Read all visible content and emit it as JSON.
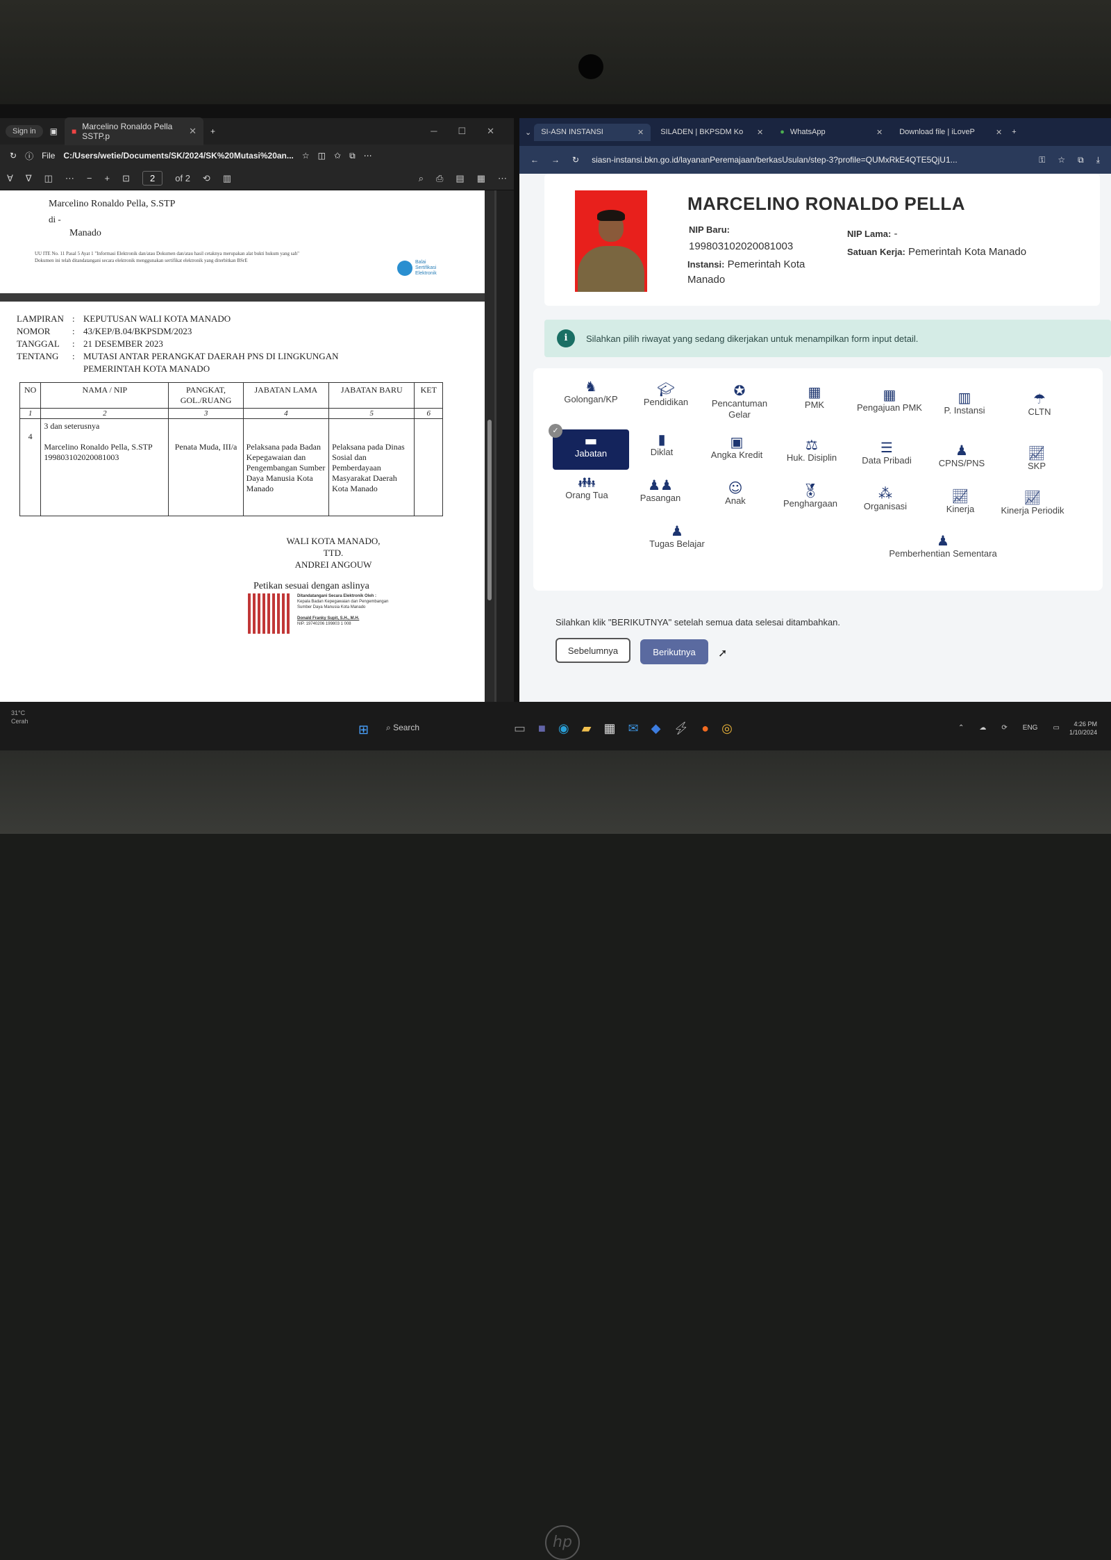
{
  "pdf": {
    "signin": "Sign in",
    "tab_title": "Marcelino Ronaldo Pella SSTP.p",
    "file_label": "File",
    "path": "C:/Users/wetie/Documents/SK/2024/SK%20Mutasi%20an...",
    "page_current": "2",
    "page_total": "of 2",
    "page1": {
      "name": "Marcelino Ronaldo Pella, S.STP",
      "di": "di -",
      "city": "Manado",
      "footnote1": "UU ITE No. 11 Pasal 5 Ayat 1 \"Informasi Elektronik dan/atau Dokumen dan/atau hasil cetaknya merupakan alat bukti hukum yang sah\"",
      "footnote2": "Dokumen ini telah ditandatangani secara elektronik menggunakan sertifikat elektronik yang diterbitkan BSrE",
      "bsre": "Balai Sertifikasi Elektronik"
    },
    "lampiran": {
      "k1": "LAMPIRAN",
      "v1": "KEPUTUSAN WALI KOTA MANADO",
      "k2": "NOMOR",
      "v2": "43/KEP/B.04/BKPSDM/2023",
      "k3": "TANGGAL",
      "v3": "21 DESEMBER 2023",
      "k4": "TENTANG",
      "v4": "MUTASI ANTAR PERANGKAT DAERAH PNS DI LINGKUNGAN",
      "v4b": "PEMERINTAH KOTA MANADO"
    },
    "table": {
      "h_no": "NO",
      "h_nama": "NAMA / NIP",
      "h_pangkat": "PANGKAT, GOL./RUANG",
      "h_lama": "JABATAN LAMA",
      "h_baru": "JABATAN BARU",
      "h_ket": "KET",
      "n1": "1",
      "n2": "2",
      "n3": "3",
      "n4": "4",
      "n5": "5",
      "n6": "6",
      "seterusnya": "3 dan seterusnya",
      "row_no": "4",
      "row_nama": "Marcelino Ronaldo Pella, S.STP 199803102020081003",
      "row_pangkat": "Penata Muda, III/a",
      "row_lama": "Pelaksana pada Badan Kepegawaian dan Pengembangan Sumber Daya Manusia Kota Manado",
      "row_baru": "Pelaksana pada Dinas Sosial dan Pemberdayaan Masyarakat Daerah Kota Manado"
    },
    "sign1": "WALI KOTA MANADO,",
    "sign2": "TTD.",
    "sign3": "ANDREI ANGOUW",
    "petikan": "Petikan sesuai dengan aslinya",
    "qr_line1": "Ditandatangani Secara Elektronik Oleh :",
    "qr_line2": "Kepala Badan Kepegawaian dan Pengembangan Sumber Daya Manusia Kota Manado",
    "qr_line3": "Donald Franky Supit, S.H., M.H.",
    "qr_line4": "NIP. 19740206 199803 1 008"
  },
  "browser": {
    "tabs": [
      {
        "label": "SI-ASN INSTANSI"
      },
      {
        "label": "SILADEN | BKPSDM Ko"
      },
      {
        "label": "WhatsApp"
      },
      {
        "label": "Download file | iLoveP"
      }
    ],
    "url": "siasn-instansi.bkn.go.id/layananPeremajaan/berkasUsulan/step-3?profile=QUMxRkE4QTE5QjU1..."
  },
  "profile": {
    "name": "MARCELINO RONALDO PELLA",
    "nip_baru_label": "NIP Baru:",
    "nip_baru": "199803102020081003",
    "instansi_label": "Instansi:",
    "instansi": "Pemerintah Kota Manado",
    "nip_lama_label": "NIP Lama:",
    "nip_lama": "-",
    "satuan_label": "Satuan Kerja:",
    "satuan": "Pemerintah Kota Manado"
  },
  "alert": "Silahkan pilih riwayat yang sedang dikerjakan untuk menampilkan form input detail.",
  "menu": [
    {
      "label": "Golongan/KP",
      "icon": "user-rank-icon"
    },
    {
      "label": "Pendidikan",
      "icon": "graduation-cap-icon"
    },
    {
      "label": "Pencantuman Gelar",
      "icon": "award-icon"
    },
    {
      "label": "PMK",
      "icon": "calendar-icon"
    },
    {
      "label": "Pengajuan PMK",
      "icon": "calendar-icon"
    },
    {
      "label": "P. Instansi",
      "icon": "building-icon"
    },
    {
      "label": "CLTN",
      "icon": "umbrella-icon"
    },
    {
      "label": "Jabatan",
      "icon": "briefcase-icon"
    },
    {
      "label": "Diklat",
      "icon": "book-icon"
    },
    {
      "label": "Angka Kredit",
      "icon": "money-icon"
    },
    {
      "label": "Huk. Disiplin",
      "icon": "scale-icon"
    },
    {
      "label": "Data Pribadi",
      "icon": "database-icon"
    },
    {
      "label": "CPNS/PNS",
      "icon": "user-tie-icon"
    },
    {
      "label": "SKP",
      "icon": "chart-icon"
    },
    {
      "label": "Orang Tua",
      "icon": "family-icon"
    },
    {
      "label": "Pasangan",
      "icon": "couple-icon"
    },
    {
      "label": "Anak",
      "icon": "child-icon"
    },
    {
      "label": "Penghargaan",
      "icon": "medal-icon"
    },
    {
      "label": "Organisasi",
      "icon": "network-icon"
    },
    {
      "label": "Kinerja",
      "icon": "chart-icon"
    },
    {
      "label": "Kinerja Periodik",
      "icon": "chart-icon"
    },
    {
      "label": "Tugas Belajar",
      "icon": "user-study-icon"
    },
    {
      "label": "Pemberhentian Sementara",
      "icon": "user-stop-icon"
    }
  ],
  "hint": "Silahkan klik \"BERIKUTNYA\" setelah semua data selesai ditambahkan.",
  "btn_prev": "Sebelumnya",
  "btn_next": "Berikutnya",
  "taskbar": {
    "temp": "31°C",
    "weather": "Cerah",
    "search": "Search",
    "lang": "ENG",
    "time": "4:26 PM",
    "date": "1/10/2024"
  }
}
